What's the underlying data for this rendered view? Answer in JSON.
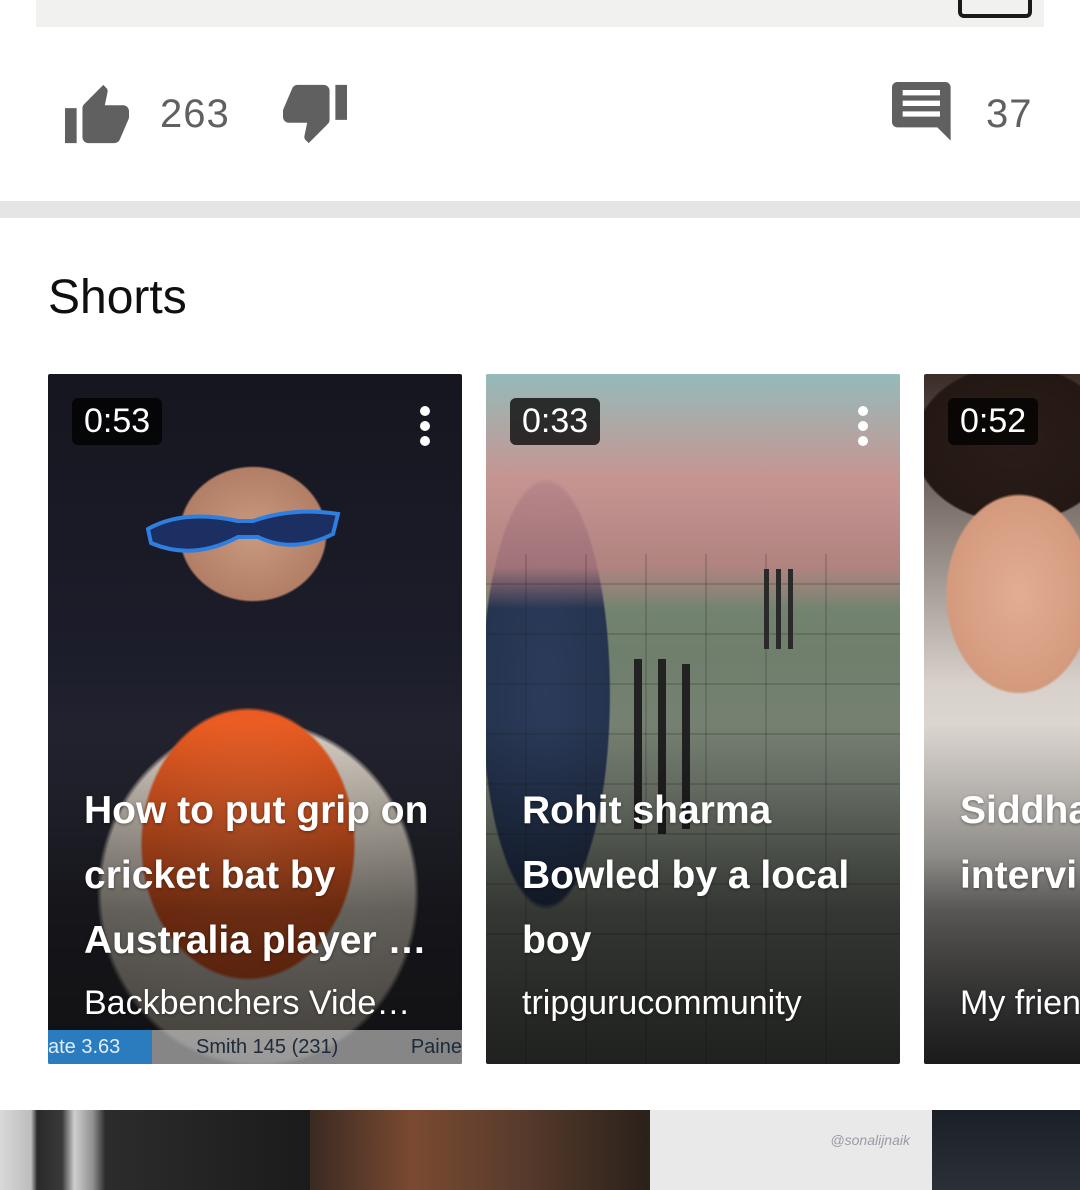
{
  "actions": {
    "like_count": "263",
    "comment_count": "37"
  },
  "shorts": {
    "title": "Shorts",
    "items": [
      {
        "duration": "0:53",
        "title": "How to put grip on cricket bat by Australia player …",
        "channel": "Backbenchers Vide…",
        "overlay": {
          "left": "ate 3.63",
          "mid": "Smith 145 (231)",
          "right": "Paine"
        }
      },
      {
        "duration": "0:33",
        "title": "Rohit sharma Bowled by a local boy",
        "channel": "tripgurucommunity"
      },
      {
        "duration": "0:52",
        "title": "Siddha and Av intervi",
        "channel": "My frien"
      }
    ]
  },
  "bottom": {
    "watermark": "@sonalijnaik"
  },
  "colors": {
    "divider": "#e5e5e5",
    "icon": "#606060",
    "text": "#0f0f0f"
  },
  "icons": [
    "thumb-up-icon",
    "thumb-down-icon",
    "comment-icon",
    "more-vert-icon"
  ]
}
